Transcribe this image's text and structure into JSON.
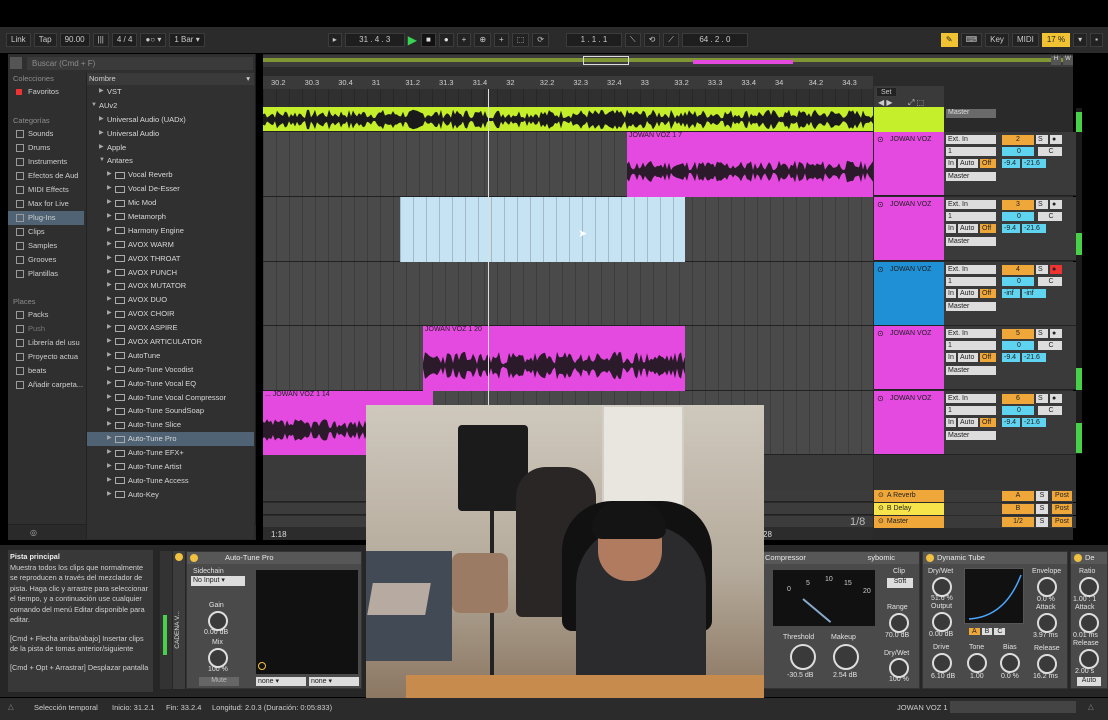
{
  "toolbar": {
    "link": "Link",
    "tap": "Tap",
    "tempo": "90.00",
    "meter": "4 / 4",
    "quantize": "1 Bar",
    "position": "31 .  4 .  3",
    "loop_start": "1 .  1 .  1",
    "loop_length": "64 .  2 .  0",
    "key": "Key",
    "midi": "MIDI",
    "cpu": "17 %"
  },
  "browser": {
    "search_placeholder": "Buscar (Cmd + F)",
    "collections_header": "Colecciones",
    "favorites": "Favoritos",
    "categories_header": "Categorías",
    "categories": [
      "Sounds",
      "Drums",
      "Instruments",
      "Efectos de Aud",
      "MIDI Effects",
      "Max for Live",
      "Plug-Ins",
      "Clips",
      "Samples",
      "Grooves",
      "Plantillas"
    ],
    "selected_category": "Plug-Ins",
    "places_header": "Places",
    "places": [
      "Packs",
      "Push",
      "Librería del usu",
      "Proyecto actua",
      "beats",
      "Añadir carpeta..."
    ],
    "tree_header": "Nombre",
    "tree": [
      {
        "label": "VST",
        "level": 1,
        "arrow": "▶",
        "plug": false
      },
      {
        "label": "AUv2",
        "level": 0,
        "arrow": "▼",
        "plug": false
      },
      {
        "label": "Universal Audio (UADx)",
        "level": 1,
        "arrow": "▶",
        "plug": false
      },
      {
        "label": "Universal Audio",
        "level": 1,
        "arrow": "▶",
        "plug": false
      },
      {
        "label": "Apple",
        "level": 1,
        "arrow": "▶",
        "plug": false
      },
      {
        "label": "Antares",
        "level": 1,
        "arrow": "▼",
        "plug": false
      },
      {
        "label": "Vocal Reverb",
        "level": 2,
        "arrow": "▶",
        "plug": true
      },
      {
        "label": "Vocal De-Esser",
        "level": 2,
        "arrow": "▶",
        "plug": true
      },
      {
        "label": "Mic Mod",
        "level": 2,
        "arrow": "▶",
        "plug": true
      },
      {
        "label": "Metamorph",
        "level": 2,
        "arrow": "▶",
        "plug": true
      },
      {
        "label": "Harmony Engine",
        "level": 2,
        "arrow": "▶",
        "plug": true
      },
      {
        "label": "AVOX WARM",
        "level": 2,
        "arrow": "▶",
        "plug": true
      },
      {
        "label": "AVOX THROAT",
        "level": 2,
        "arrow": "▶",
        "plug": true
      },
      {
        "label": "AVOX PUNCH",
        "level": 2,
        "arrow": "▶",
        "plug": true
      },
      {
        "label": "AVOX MUTATOR",
        "level": 2,
        "arrow": "▶",
        "plug": true
      },
      {
        "label": "AVOX DUO",
        "level": 2,
        "arrow": "▶",
        "plug": true
      },
      {
        "label": "AVOX CHOIR",
        "level": 2,
        "arrow": "▶",
        "plug": true
      },
      {
        "label": "AVOX ASPIRE",
        "level": 2,
        "arrow": "▶",
        "plug": true
      },
      {
        "label": "AVOX ARTICULATOR",
        "level": 2,
        "arrow": "▶",
        "plug": true
      },
      {
        "label": "AutoTune",
        "level": 2,
        "arrow": "▶",
        "plug": true
      },
      {
        "label": "Auto-Tune Vocodist",
        "level": 2,
        "arrow": "▶",
        "plug": true
      },
      {
        "label": "Auto-Tune Vocal EQ",
        "level": 2,
        "arrow": "▶",
        "plug": true
      },
      {
        "label": "Auto-Tune Vocal Compressor",
        "level": 2,
        "arrow": "▶",
        "plug": true
      },
      {
        "label": "Auto-Tune SoundSoap",
        "level": 2,
        "arrow": "▶",
        "plug": true
      },
      {
        "label": "Auto-Tune Slice",
        "level": 2,
        "arrow": "▶",
        "plug": true
      },
      {
        "label": "Auto-Tune Pro",
        "level": 2,
        "arrow": "▶",
        "plug": true,
        "selected": true
      },
      {
        "label": "Auto-Tune EFX+",
        "level": 2,
        "arrow": "▶",
        "plug": true
      },
      {
        "label": "Auto-Tune Artist",
        "level": 2,
        "arrow": "▶",
        "plug": true
      },
      {
        "label": "Auto-Tune Access",
        "level": 2,
        "arrow": "▶",
        "plug": true
      },
      {
        "label": "Auto-Key",
        "level": 2,
        "arrow": "▶",
        "plug": true
      }
    ]
  },
  "ruler": [
    "30.2",
    "30.3",
    "30.4",
    "31",
    "31.2",
    "31.3",
    "31.4",
    "32",
    "32.2",
    "32.3",
    "32.4",
    "33",
    "33.2",
    "33.3",
    "33.4",
    "34",
    "34.2",
    "34.3"
  ],
  "arrangement": {
    "set_label": "Set",
    "loop_region": "1/8",
    "marker_left": "1:18",
    "marker_right": "28"
  },
  "clips": {
    "clip1": "JOWAN VOZ 1 7",
    "clip2": "JOWAN VOZ 1 20",
    "clip3": "... JOWAN VOZ 1 14"
  },
  "tracks": [
    {
      "name": "JOWAN VOZ",
      "num": "2",
      "vol": "-9.4",
      "pan": "-21.6",
      "input": "Ext. In",
      "chan": "1",
      "out": "Master",
      "pan_c": "C",
      "zero": "0"
    },
    {
      "name": "JOWAN VOZ",
      "num": "3",
      "vol": "-9.4",
      "pan": "-21.6",
      "input": "Ext. In",
      "chan": "1",
      "out": "Master",
      "pan_c": "C",
      "zero": "0"
    },
    {
      "name": "JOWAN VOZ",
      "num": "4",
      "vol": "-inf",
      "pan": "-inf",
      "input": "Ext. In",
      "chan": "1",
      "out": "Master",
      "pan_c": "C",
      "zero": "0"
    },
    {
      "name": "JOWAN VOZ",
      "num": "5",
      "vol": "-9.4",
      "pan": "-21.6",
      "input": "Ext. In",
      "chan": "1",
      "out": "Master",
      "pan_c": "C",
      "zero": "0"
    },
    {
      "name": "JOWAN VOZ",
      "num": "6",
      "vol": "-9.4",
      "pan": "-21.6",
      "input": "Ext. In",
      "chan": "1",
      "out": "Master",
      "pan_c": "C",
      "zero": "0"
    }
  ],
  "mixer_labels": {
    "in": "In",
    "auto": "Auto",
    "off": "Off",
    "s": "S",
    "top_out": "Master"
  },
  "returns": [
    {
      "name": "A Reverb",
      "btn": "A"
    },
    {
      "name": "B Delay",
      "btn": "B"
    },
    {
      "name": "Master",
      "btn": "1/2"
    }
  ],
  "post": "Post",
  "help": {
    "title": "Pista principal",
    "body": "Muestra todos los clips que normalmente se reproducen a través del mezclador de pista. Haga clic y arrastre para seleccionar el tiempo, y a continuación use cualquier comando del menú Editar disponible para editar.",
    "hint1": "[Cmd + Flecha arriba/abajo] Insertar clips de la pista de tomas anterior/siguiente",
    "hint2": "[Cmd + Opt + Arrastrar] Desplazar pantalla"
  },
  "devices": {
    "autotune": {
      "title": "Auto-Tune Pro",
      "sidechain": "Sidechain",
      "no_input": "No Input",
      "gain_label": "Gain",
      "gain_val": "0.00 dB",
      "mix_label": "Mix",
      "mix_val": "100 %",
      "mute": "Mute",
      "none1": "none",
      "none2": "none",
      "chain_label": "CADENA V..."
    },
    "compressor": {
      "title": "Compressor",
      "brand": "sybomic",
      "clip": "Clip",
      "soft": "Soft",
      "range_label": "Range",
      "range_val": "70.0 dB",
      "threshold_label": "Threshold",
      "threshold_val": "-30.5 dB",
      "makeup_label": "Makeup",
      "makeup_val": "2.54 dB",
      "drywet_label": "Dry/Wet",
      "drywet_val": "100 %",
      "scale": [
        "0",
        "5",
        "10",
        "15",
        "20"
      ]
    },
    "tube": {
      "title": "Dynamic Tube",
      "drywet_label": "Dry/Wet",
      "drywet_val": "51.6 %",
      "output_label": "Output",
      "output_val": "0.00 dB",
      "drive_label": "Drive",
      "drive_val": "6.10 dB",
      "tone_label": "Tone",
      "tone_val": "1.00",
      "bias_label": "Bias",
      "bias_val": "0.0 %",
      "envelope_label": "Envelope",
      "envelope_val": "0.0 %",
      "attack_label": "Attack",
      "attack_val": "3.97 ms",
      "release_label": "Release",
      "release_val": "16.2 ms",
      "abc": [
        "A",
        "B",
        "C"
      ]
    },
    "right": {
      "title": "De",
      "ratio_label": "Ratio",
      "ratio_val": "1.00 : 1",
      "attack_label": "Attack",
      "attack_val": "0.01 ms",
      "release_label": "Release",
      "release_val": "2.00 s",
      "auto": "Auto"
    }
  },
  "status": {
    "label": "Selección temporal",
    "inicio": "Inicio: 31.2.1",
    "fin": "Fin: 33.2.4",
    "longitud": "Longitud: 2.0.3 (Duración: 0:05:833)",
    "track": "JOWAN VOZ 1"
  },
  "colors": {
    "lime": "#c6ef2b",
    "magenta": "#e449e0",
    "lightblue": "#c6e3f3",
    "blue": "#1f8fd6",
    "orange": "#f0a73a"
  }
}
